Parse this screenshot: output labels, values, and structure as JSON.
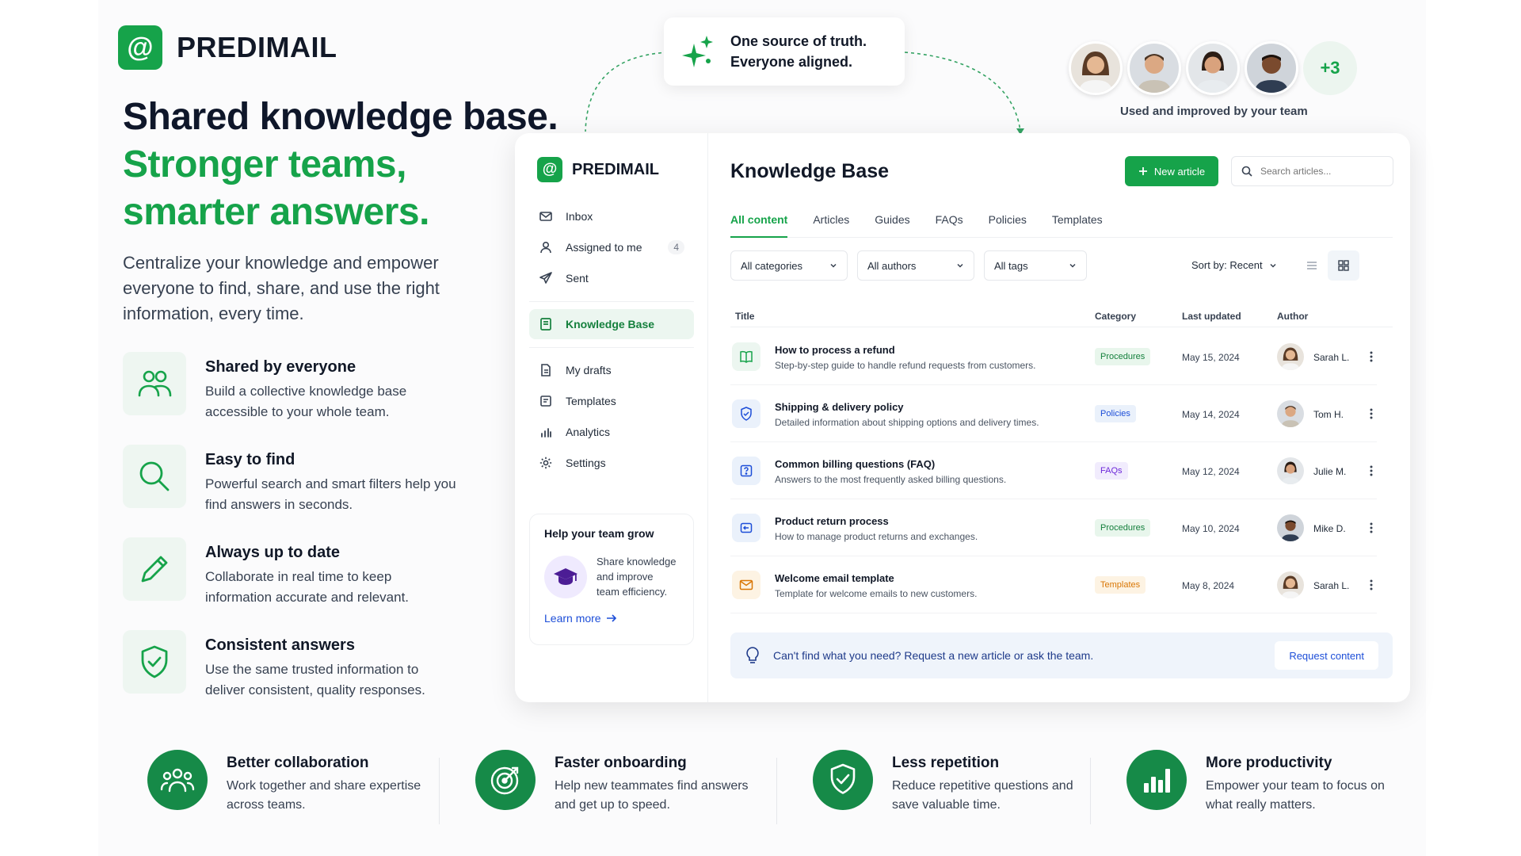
{
  "brand": {
    "name": "PREDIMAIL",
    "logo_glyph": "@"
  },
  "hero": {
    "title": "Shared knowledge base.",
    "subtitle_line1": "Stronger teams,",
    "subtitle_line2": "smarter answers.",
    "description": "Centralize your knowledge and empower everyone to find, share, and use the right information, every time."
  },
  "features": [
    {
      "icon": "users-icon",
      "title": "Shared by everyone",
      "desc": "Build a collective knowledge base accessible to your whole team."
    },
    {
      "icon": "search-icon",
      "title": "Easy to find",
      "desc": "Powerful search and smart filters help you find answers in seconds."
    },
    {
      "icon": "pencil-icon",
      "title": "Always up to date",
      "desc": "Collaborate in real time to keep information accurate and relevant."
    },
    {
      "icon": "shield-check-icon",
      "title": "Consistent answers",
      "desc": "Use the same trusted information to deliver consistent, quality responses."
    }
  ],
  "callout": {
    "line1": "One source of truth.",
    "line2": "Everyone aligned."
  },
  "team": {
    "more": "+3",
    "caption": "Used and improved by your team"
  },
  "app": {
    "brand": "PREDIMAIL",
    "sidebar": {
      "items": [
        {
          "icon": "mail-icon",
          "label": "Inbox"
        },
        {
          "icon": "user-icon",
          "label": "Assigned to me",
          "count": "4"
        },
        {
          "icon": "send-icon",
          "label": "Sent"
        },
        {
          "icon": "book-icon",
          "label": "Knowledge Base",
          "active": true
        },
        {
          "icon": "file-icon",
          "label": "My drafts"
        },
        {
          "icon": "template-icon",
          "label": "Templates"
        },
        {
          "icon": "bar-chart-icon",
          "label": "Analytics"
        },
        {
          "icon": "gear-icon",
          "label": "Settings"
        }
      ],
      "promo": {
        "title": "Help your team grow",
        "text": "Share knowledge and improve team efficiency.",
        "link": "Learn more"
      }
    },
    "main": {
      "title": "Knowledge Base",
      "new_button": "New article",
      "search_placeholder": "Search articles...",
      "tabs": [
        "All content",
        "Articles",
        "Guides",
        "FAQs",
        "Policies",
        "Templates"
      ],
      "filters": [
        "All categories",
        "All authors",
        "All tags"
      ],
      "sort": "Sort by: Recent",
      "columns": {
        "title": "Title",
        "category": "Category",
        "updated": "Last updated",
        "author": "Author"
      },
      "rows": [
        {
          "icon": "book-open-icon",
          "title": "How to process a refund",
          "desc": "Step-by-step guide to handle refund requests from customers.",
          "category": "Procedures",
          "date": "May 15, 2024",
          "author": "Sarah L."
        },
        {
          "icon": "shield-icon",
          "title": "Shipping & delivery policy",
          "desc": "Detailed information about shipping options and delivery times.",
          "category": "Policies",
          "date": "May 14, 2024",
          "author": "Tom H."
        },
        {
          "icon": "question-icon",
          "title": "Common billing questions (FAQ)",
          "desc": "Answers to the most frequently asked billing questions.",
          "category": "FAQs",
          "date": "May 12, 2024",
          "author": "Julie M."
        },
        {
          "icon": "return-icon",
          "title": "Product return process",
          "desc": "How to manage product returns and exchanges.",
          "category": "Procedures",
          "date": "May 10, 2024",
          "author": "Mike D."
        },
        {
          "icon": "envelope-icon",
          "title": "Welcome email template",
          "desc": "Template for welcome emails to new customers.",
          "category": "Templates",
          "date": "May 8, 2024",
          "author": "Sarah L."
        }
      ],
      "help": {
        "text": "Can't find what you need? Request a new article or ask the team.",
        "button": "Request content"
      }
    }
  },
  "benefits": [
    {
      "icon": "team-icon",
      "title": "Better collaboration",
      "desc": "Work together and share expertise across teams."
    },
    {
      "icon": "target-icon",
      "title": "Faster onboarding",
      "desc": "Help new teammates find answers and get up to speed."
    },
    {
      "icon": "shield-check-icon",
      "title": "Less repetition",
      "desc": "Reduce repetitive questions and save valuable time."
    },
    {
      "icon": "bar-chart-icon",
      "title": "More productivity",
      "desc": "Empower your team to focus on what really matters."
    }
  ],
  "colors": {
    "accent": "#16a34a",
    "dark_accent": "#168a48",
    "link": "#1d4ed8"
  }
}
